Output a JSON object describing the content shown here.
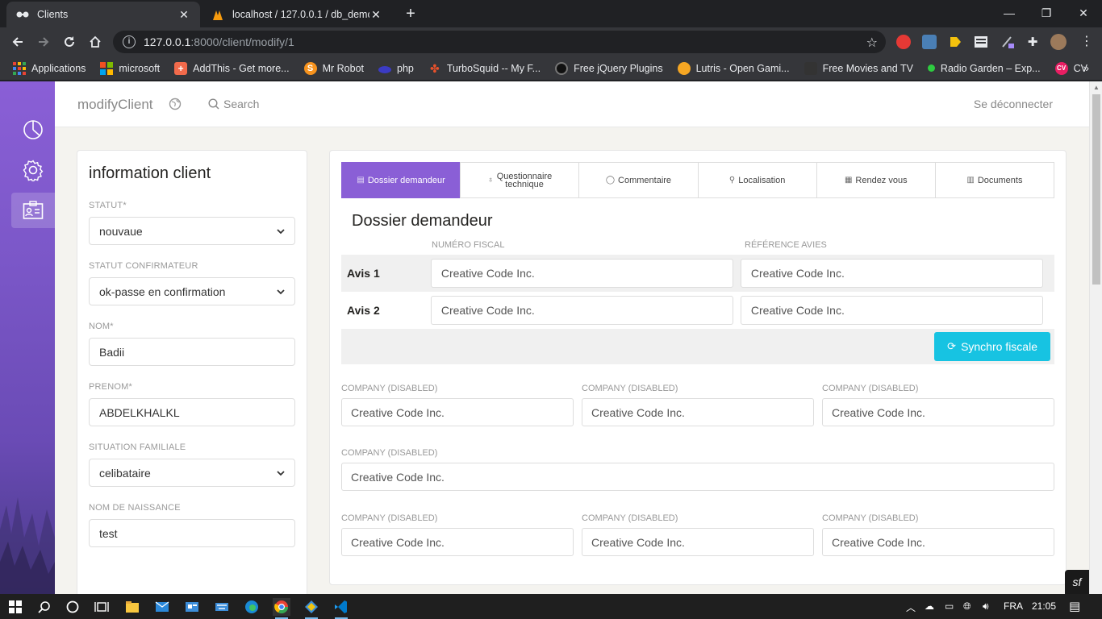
{
  "browser": {
    "tabs": [
      {
        "title": "Clients",
        "active": true
      },
      {
        "title": "localhost / 127.0.0.1 / db_demo |",
        "active": false
      }
    ],
    "url_host": "127.0.0.1",
    "url_rest": ":8000/client/modify/1",
    "bookmarks": [
      {
        "label": "Applications",
        "color": "#ea4335"
      },
      {
        "label": "microsoft",
        "color": "#f25022"
      },
      {
        "label": "AddThis - Get more...",
        "color": "#f26a4b"
      },
      {
        "label": "Mr Robot",
        "color": "#f7931e"
      },
      {
        "label": "php",
        "color": "#3b3bc4"
      },
      {
        "label": "TurboSquid -- My F...",
        "color": "#e8512b"
      },
      {
        "label": "Free jQuery Plugins",
        "color": "#222222"
      },
      {
        "label": "Lutris - Open Gami...",
        "color": "#f5a623"
      },
      {
        "label": "Free Movies and TV",
        "color": "#333333"
      },
      {
        "label": "Radio Garden – Exp...",
        "color": "#2ecc40"
      },
      {
        "label": "CV",
        "color": "#e91e63"
      }
    ]
  },
  "app": {
    "brand": "modifyClient",
    "search_label": "Search",
    "logout_label": "Se déconnecter",
    "accent_color": "#8a5fd6",
    "button_color": "#17c3e2"
  },
  "left_card": {
    "title": "information client",
    "fields": [
      {
        "label": "STATUT*",
        "value": "nouvaue",
        "type": "select"
      },
      {
        "label": "STATUT CONFIRMATEUR",
        "value": "ok-passe en confirmation",
        "type": "select"
      },
      {
        "label": "NOM*",
        "value": "Badii",
        "type": "input"
      },
      {
        "label": "PRENOM*",
        "value": "ABDELKHALKL",
        "type": "input"
      },
      {
        "label": "SITUATION FAMILIALE",
        "value": "celibataire",
        "type": "select"
      },
      {
        "label": "NOM DE NAISSANCE",
        "value": "test",
        "type": "input"
      }
    ]
  },
  "right_card": {
    "tabs": [
      {
        "label": "Dossier demandeur",
        "line2": "",
        "active": true
      },
      {
        "label": "Questionnaire",
        "line2": "technique",
        "active": false
      },
      {
        "label": "Commentaire",
        "line2": "",
        "active": false
      },
      {
        "label": "Localisation",
        "line2": "",
        "active": false
      },
      {
        "label": "Rendez vous",
        "line2": "",
        "active": false
      },
      {
        "label": "Documents",
        "line2": "",
        "active": false
      }
    ],
    "section_title": "Dossier demandeur",
    "col_fiscal": "NUMÉRO FISCAL",
    "col_ref": "RÉFÉRENCE AVIES",
    "avis": [
      {
        "label": "Avis 1",
        "fiscal": "Creative Code Inc.",
        "ref": "Creative Code Inc."
      },
      {
        "label": "Avis 2",
        "fiscal": "Creative Code Inc.",
        "ref": "Creative Code Inc."
      }
    ],
    "sync_label": "Synchro fiscale",
    "company_label": "COMPANY (DISABLED)",
    "company_value": "Creative Code Inc."
  },
  "taskbar": {
    "lang": "FRA",
    "time": "21:05"
  }
}
